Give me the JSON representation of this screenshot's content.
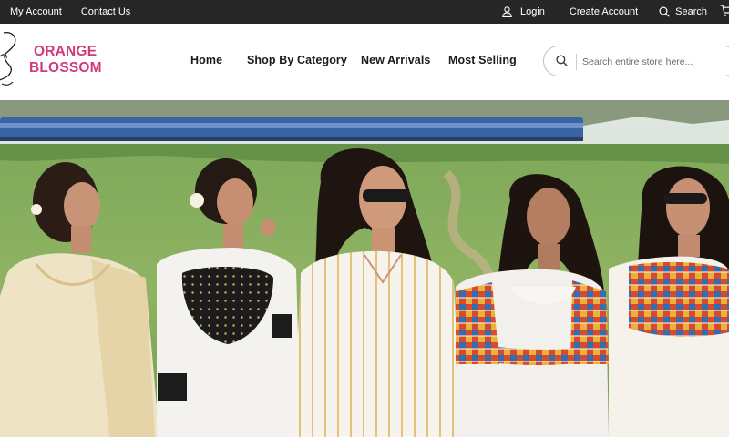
{
  "topbar": {
    "my_account": "My Account",
    "contact_us": "Contact Us",
    "login": "Login",
    "create_account": "Create Account",
    "search": "Search"
  },
  "brand": {
    "line1": "ORANGE",
    "line2": "BLOSSOM",
    "color": "#d2387c"
  },
  "nav": {
    "home": "Home",
    "shop_by_category": "Shop By Category",
    "new_arrivals": "New Arrivals",
    "most_selling": "Most Selling"
  },
  "search": {
    "placeholder": "Search entire store here..."
  },
  "icons": {
    "login": "user-icon",
    "search": "search-icon",
    "cart": "cart-icon",
    "logo": "flower-outline-icon"
  },
  "colors": {
    "topbar_bg": "#262626",
    "accent": "#d2387c",
    "nav_text": "#1a1a1a"
  }
}
